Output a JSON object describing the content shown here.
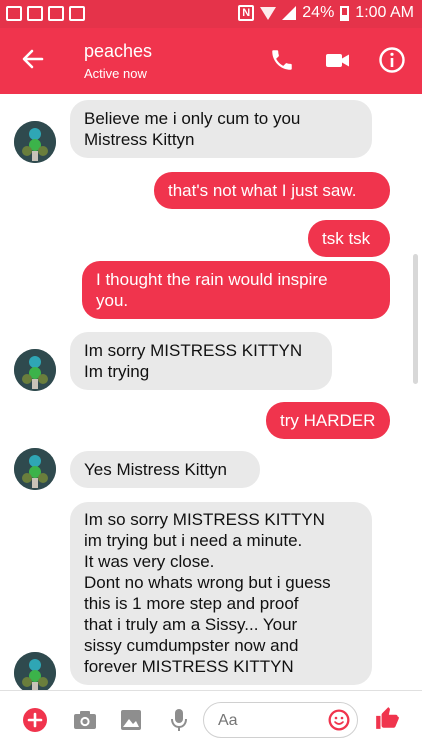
{
  "status": {
    "battery": "24%",
    "time": "1:00 AM"
  },
  "header": {
    "name": "peaches",
    "presence": "Active now"
  },
  "messages": [
    {
      "from": "them",
      "text": "Believe me i only cum to you\nMistress Kittyn"
    },
    {
      "from": "me",
      "text": "that's not what I just saw."
    },
    {
      "from": "me",
      "text": "tsk tsk"
    },
    {
      "from": "me",
      "text": "I thought the rain would inspire\nyou."
    },
    {
      "from": "them",
      "text": "Im sorry MISTRESS KITTYN\nIm trying"
    },
    {
      "from": "me",
      "text": "try HARDER"
    },
    {
      "from": "them",
      "text": "Yes Mistress Kittyn"
    },
    {
      "from": "them",
      "text": "Im so sorry MISTRESS KITTYN\nim trying but i need a minute.\n It was very close.\nDont no whats wrong but i guess\nthis is 1 more step and proof\nthat i truly am a Sissy... Your\nsissy cumdumpster now and\nforever MISTRESS KITTYN"
    }
  ],
  "composer": {
    "placeholder": "Aa"
  },
  "colors": {
    "brand": "#f0344d",
    "incoming": "#e9e9e9"
  },
  "icons": [
    "back-arrow-icon",
    "phone-icon",
    "video-icon",
    "info-icon",
    "plus-icon",
    "camera-icon",
    "image-icon",
    "mic-icon",
    "emoji-icon",
    "thumbs-up-icon"
  ]
}
